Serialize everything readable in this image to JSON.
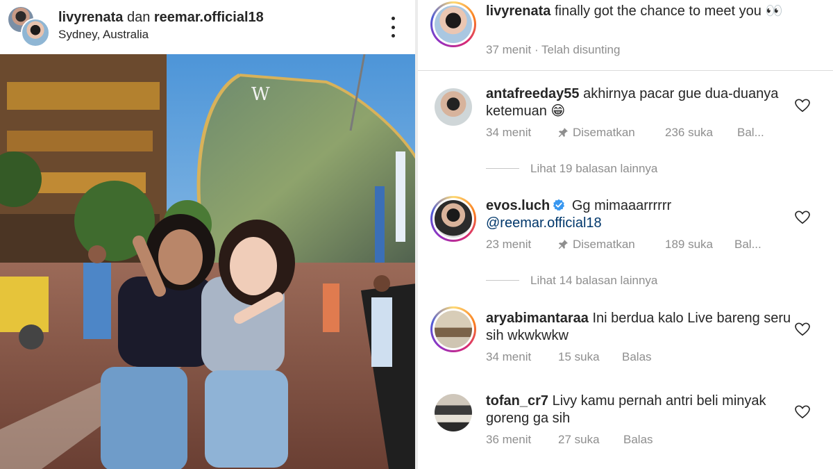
{
  "post": {
    "user_primary": "livyrenata",
    "user_joiner": "dan",
    "user_secondary": "reemar.official18",
    "location": "Sydney, Australia",
    "more_icon": "more-vertical-icon",
    "photo_sign_letter": "W"
  },
  "caption": {
    "username": "livyrenata",
    "text": "finally got the chance to meet you 👀",
    "time": "37 menit",
    "separator": "·",
    "edited": "Telah disunting"
  },
  "comments": [
    {
      "username": "antafreeday55",
      "text": "akhirnya pacar gue dua-duanya ketemuan 😁",
      "time": "34 menit",
      "pinned": "Disematkan",
      "likes": "236 suka",
      "reply": "Bal...",
      "view_replies": "Lihat 19 balasan lainnya",
      "verified": false
    },
    {
      "username": "evos.luch",
      "text": "Gg mimaaarrrrrr",
      "mention": "@reemar.official18",
      "time": "23 menit",
      "pinned": "Disematkan",
      "likes": "189 suka",
      "reply": "Bal...",
      "view_replies": "Lihat 14 balasan lainnya",
      "verified": true
    },
    {
      "username": "aryabimantaraa",
      "text": "Ini berdua kalo Live bareng seru sih wkwkwkw",
      "time": "34 menit",
      "likes": "15 suka",
      "reply": "Balas",
      "verified": false
    },
    {
      "username": "tofan_cr7",
      "text": "Livy kamu pernah antri beli minyak goreng ga sih",
      "time": "36 menit",
      "likes": "27 suka",
      "reply": "Balas",
      "verified": false
    }
  ],
  "colors": {
    "text": "#262626",
    "secondary": "#8e8e8e",
    "mention": "#00376b",
    "verified": "#3897f0",
    "divider": "#dbdbdb"
  },
  "icons": [
    "more-vertical-icon",
    "pin-icon",
    "heart-icon",
    "verified-badge-icon"
  ]
}
